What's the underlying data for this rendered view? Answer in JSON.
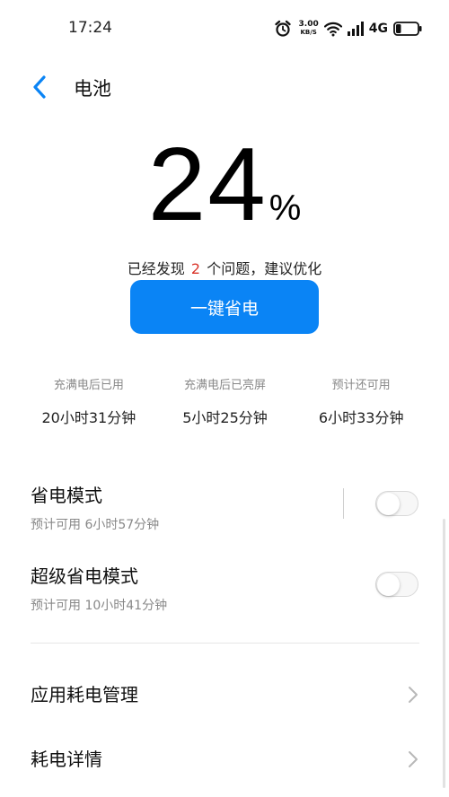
{
  "status_bar": {
    "time": "17:24",
    "net_speed_value": "3.00",
    "net_speed_unit": "KB/S",
    "network_type": "4G",
    "icons": [
      "alarm-icon",
      "wifi-icon",
      "signal-icon",
      "battery-icon"
    ]
  },
  "header": {
    "title": "电池"
  },
  "battery": {
    "level": "24",
    "unit": "%",
    "fill_fraction": 0.24
  },
  "issues": {
    "prefix": "已经发现",
    "count": "2",
    "suffix": "个问题，建议优化",
    "count_color": "#d9352b"
  },
  "optimize_button": {
    "label": "一键省电",
    "color": "#0a84f5"
  },
  "stats": [
    {
      "label": "充满电后已用",
      "value": "20小时31分钟"
    },
    {
      "label": "充满电后已亮屏",
      "value": "5小时25分钟"
    },
    {
      "label": "预计还可用",
      "value": "6小时33分钟"
    }
  ],
  "modes": [
    {
      "title": "省电模式",
      "subtitle": "预计可用 6小时57分钟",
      "enabled": false
    },
    {
      "title": "超级省电模式",
      "subtitle": "预计可用 10小时41分钟",
      "enabled": false
    }
  ],
  "nav_items": [
    {
      "label": "应用耗电管理"
    },
    {
      "label": "耗电详情"
    }
  ]
}
